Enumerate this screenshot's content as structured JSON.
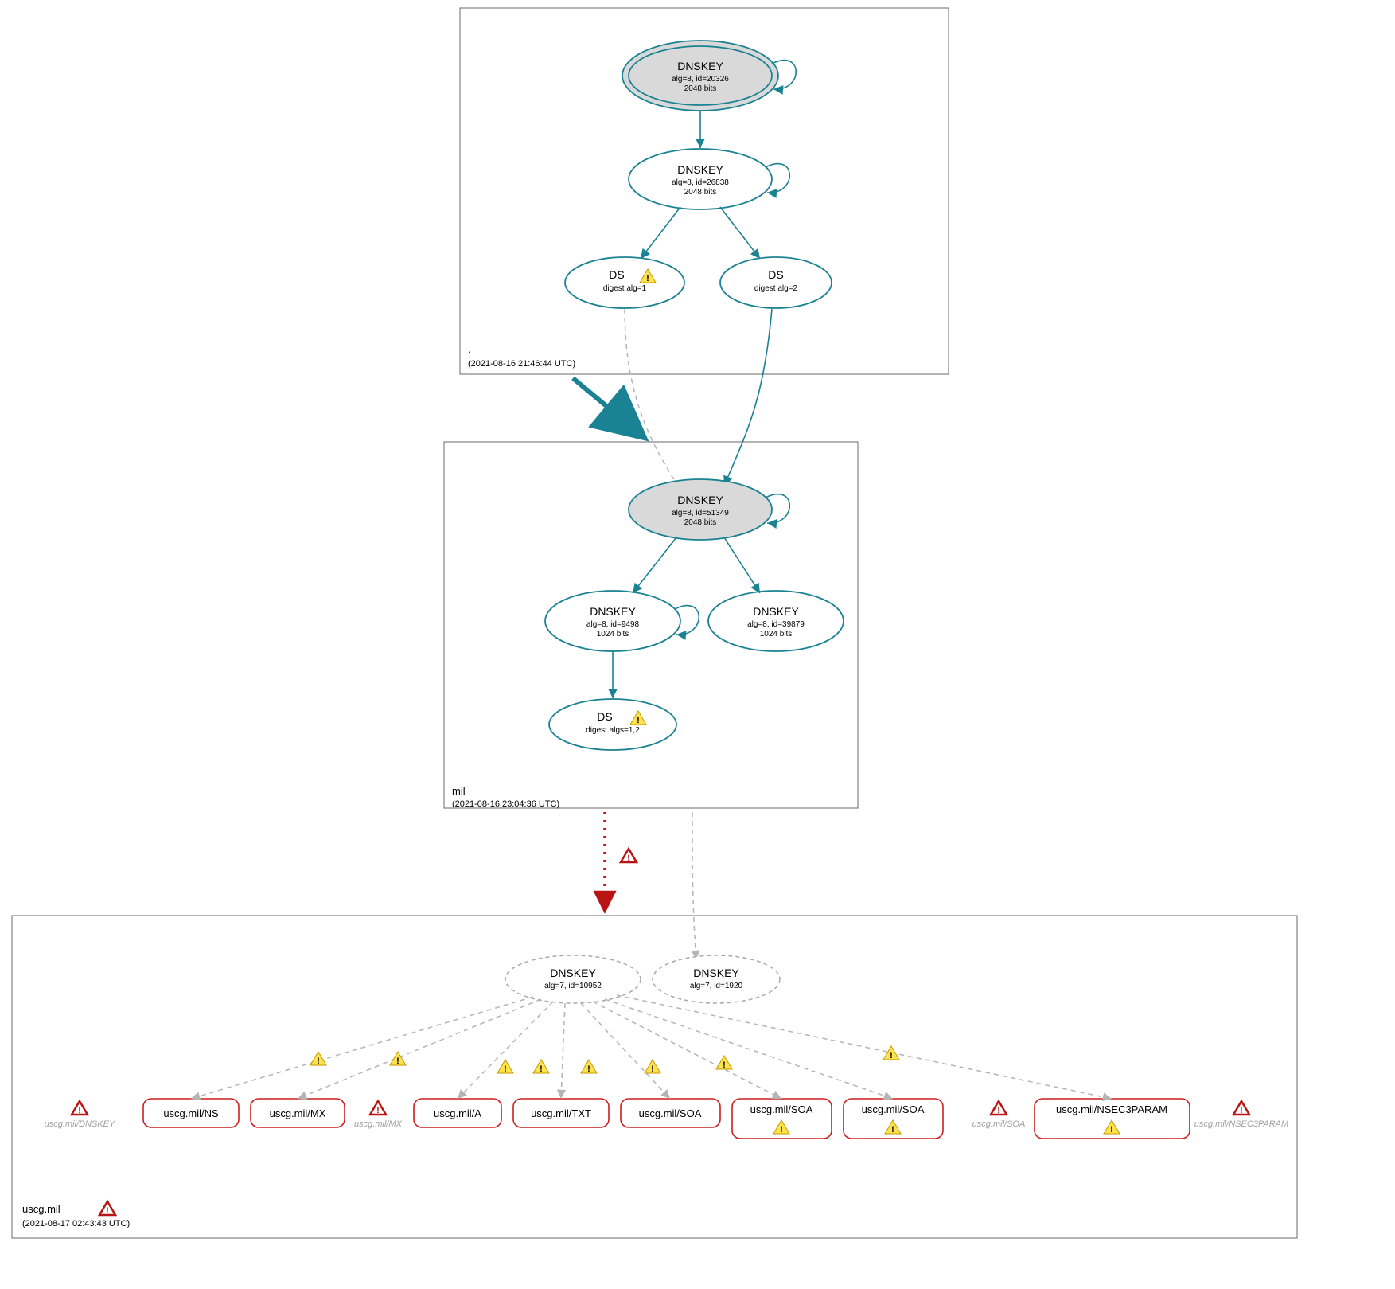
{
  "zones": {
    "root": {
      "label": ".",
      "timestamp": "(2021-08-16 21:46:44 UTC)"
    },
    "mil": {
      "label": "mil",
      "timestamp": "(2021-08-16 23:04:36 UTC)"
    },
    "uscg": {
      "label": "uscg.mil",
      "timestamp": "(2021-08-17 02:43:43 UTC)"
    }
  },
  "nodes": {
    "root_ksk": {
      "title": "DNSKEY",
      "line1": "alg=8, id=20326",
      "line2": "2048 bits"
    },
    "root_zsk": {
      "title": "DNSKEY",
      "line1": "alg=8, id=26838",
      "line2": "2048 bits"
    },
    "root_ds1": {
      "title": "DS",
      "line1": "digest alg=1"
    },
    "root_ds2": {
      "title": "DS",
      "line1": "digest alg=2"
    },
    "mil_ksk": {
      "title": "DNSKEY",
      "line1": "alg=8, id=51349",
      "line2": "2048 bits"
    },
    "mil_zsk1": {
      "title": "DNSKEY",
      "line1": "alg=8, id=9498",
      "line2": "1024 bits"
    },
    "mil_zsk2": {
      "title": "DNSKEY",
      "line1": "alg=8, id=39879",
      "line2": "1024 bits"
    },
    "mil_ds": {
      "title": "DS",
      "line1": "digest algs=1,2"
    },
    "uscg_key1": {
      "title": "DNSKEY",
      "line1": "alg=7, id=10952"
    },
    "uscg_key2": {
      "title": "DNSKEY",
      "line1": "alg=7, id=1920"
    }
  },
  "rrsets": {
    "ns": {
      "label": "uscg.mil/NS"
    },
    "mx": {
      "label": "uscg.mil/MX"
    },
    "a": {
      "label": "uscg.mil/A"
    },
    "txt": {
      "label": "uscg.mil/TXT"
    },
    "soa1": {
      "label": "uscg.mil/SOA"
    },
    "soa2": {
      "label": "uscg.mil/SOA"
    },
    "soa3": {
      "label": "uscg.mil/SOA"
    },
    "nsec3p": {
      "label": "uscg.mil/NSEC3PARAM"
    }
  },
  "unsigned": {
    "dnskey": "uscg.mil/DNSKEY",
    "mx": "uscg.mil/MX",
    "soa": "uscg.mil/SOA",
    "nsec3p": "uscg.mil/NSEC3PARAM"
  }
}
